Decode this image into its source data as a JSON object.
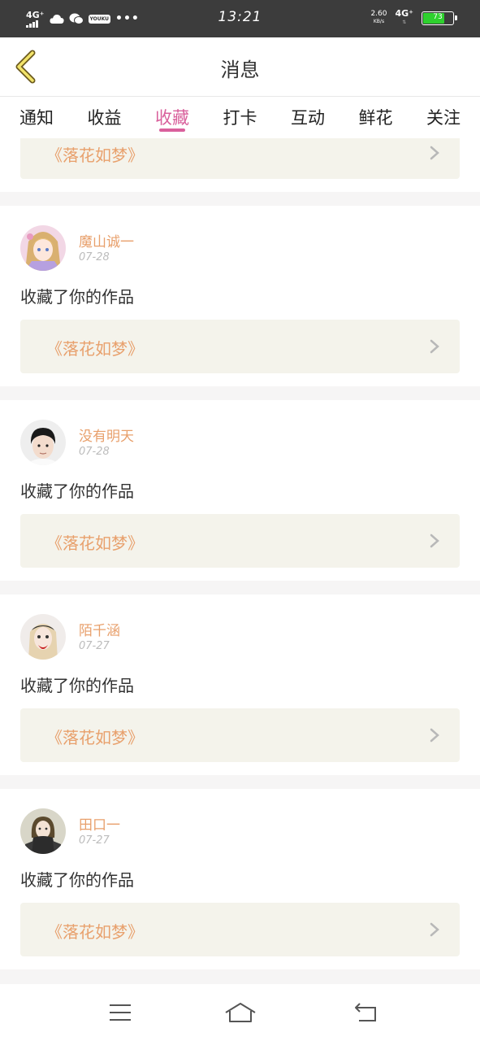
{
  "status_bar": {
    "network_left": "4G⁺",
    "youku_label": "YOUKU",
    "more": "•••",
    "time": "13:21",
    "speed_value": "2.60",
    "speed_unit": "KB/s",
    "network_right": "4G⁺",
    "battery_level": "73",
    "battery_fraction": 0.73,
    "battery_color": "#2ed12e"
  },
  "header": {
    "title": "消息",
    "back_icon": "chevron-left-icon"
  },
  "tabs": [
    {
      "label": "通知",
      "active": false
    },
    {
      "label": "收益",
      "active": false
    },
    {
      "label": "收藏",
      "active": true
    },
    {
      "label": "打卡",
      "active": false
    },
    {
      "label": "互动",
      "active": false
    },
    {
      "label": "鲜花",
      "active": false
    },
    {
      "label": "关注",
      "active": false
    }
  ],
  "colors": {
    "accent": "#d9609c",
    "name": "#e8a06c",
    "card_bg": "#f4f3eb"
  },
  "feed": {
    "partial_card": {
      "work_title": "《落花如梦》"
    },
    "items": [
      {
        "username": "魔山诚一",
        "date": "07-28",
        "action": "收藏了你的作品",
        "work_title": "《落花如梦》"
      },
      {
        "username": "没有明天",
        "date": "07-28",
        "action": "收藏了你的作品",
        "work_title": "《落花如梦》"
      },
      {
        "username": "陌千涵",
        "date": "07-27",
        "action": "收藏了你的作品",
        "work_title": "《落花如梦》"
      },
      {
        "username": "田口一",
        "date": "07-27",
        "action": "收藏了你的作品",
        "work_title": "《落花如梦》"
      }
    ]
  },
  "nav_bar": {
    "menu_icon": "menu-icon",
    "home_icon": "home-icon",
    "back_icon": "return-icon"
  }
}
